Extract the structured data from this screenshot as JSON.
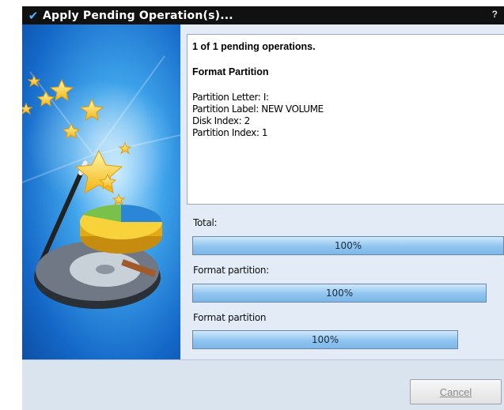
{
  "window": {
    "title": "Apply Pending Operation(s)...",
    "help": "?"
  },
  "info": {
    "summary": "1 of 1 pending operations.",
    "operation": "Format Partition",
    "details": [
      "Partition Letter: I:",
      "Partition Label: NEW VOLUME",
      "Disk Index: 2",
      "Partition Index: 1"
    ]
  },
  "progress": [
    {
      "label": "Total:",
      "value": "100%",
      "fraction": 1.0
    },
    {
      "label": "Format partition:",
      "value": "100%",
      "fraction": 1.0
    },
    {
      "label": "Format partition",
      "value": "100%",
      "fraction": 1.0
    }
  ],
  "footer": {
    "cancel_label": "Cancel"
  },
  "colors": {
    "title_bg": "#111111",
    "side_accent": "#1467c7",
    "progress_fill": "#8fc4ef"
  }
}
